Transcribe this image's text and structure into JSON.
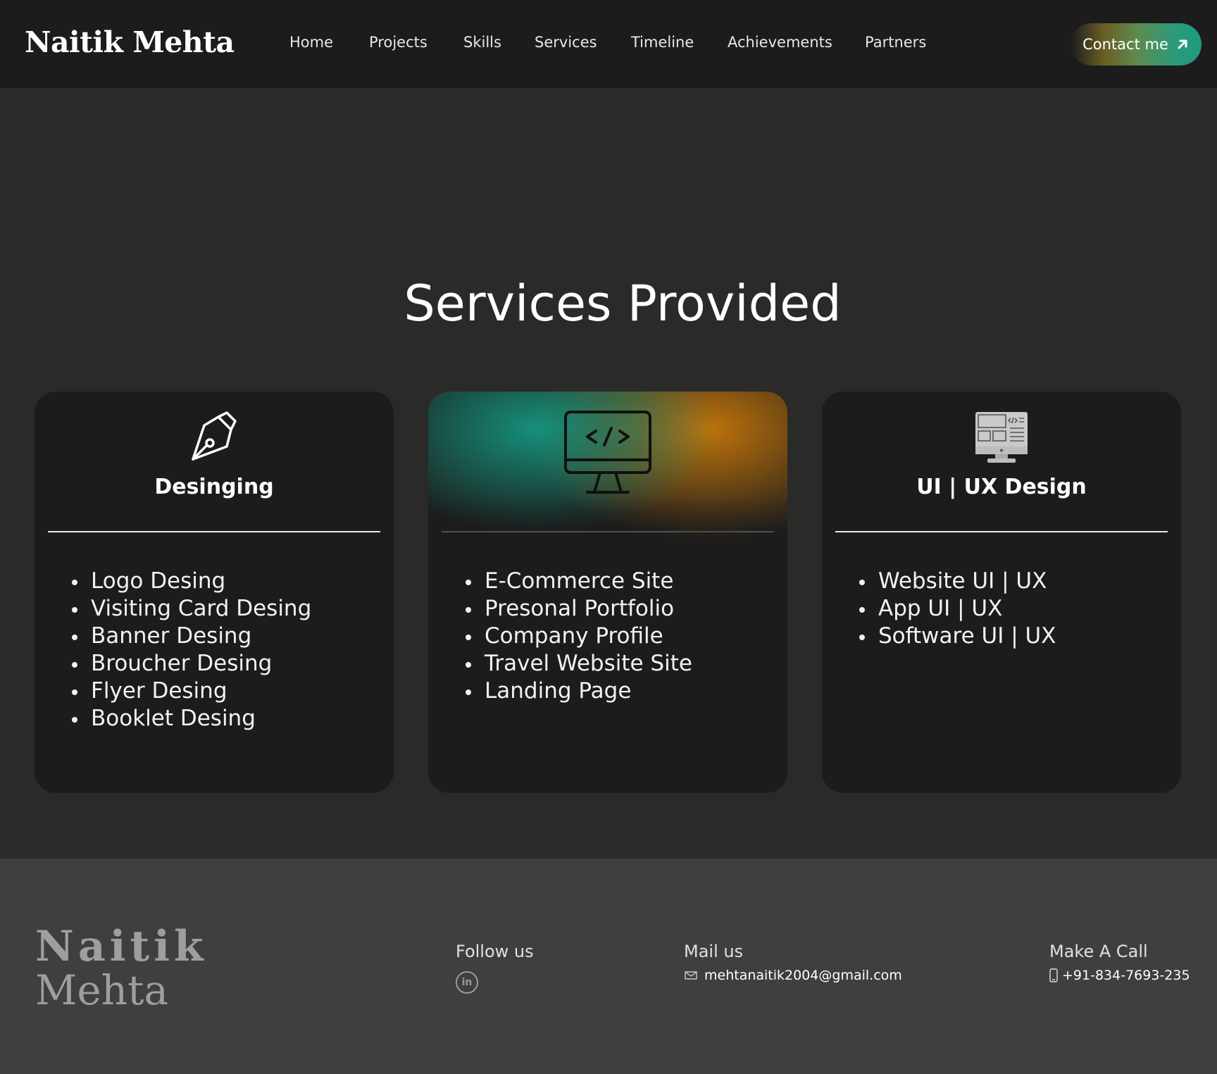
{
  "header": {
    "brand": "Naitik Mehta",
    "nav": [
      "Home",
      "Projects",
      "Skills",
      "Services",
      "Timeline",
      "Achievements",
      "Partners"
    ],
    "contact_label": "Contact me",
    "contact_icon": "arrow-up-right-icon"
  },
  "main": {
    "title": "Services Provided",
    "cards": [
      {
        "icon": "pen-tool-icon",
        "title": "Desinging",
        "items": [
          "Logo Desing",
          "Visiting Card Desing",
          "Banner Desing",
          "Broucher Desing",
          "Flyer Desing",
          "Booklet Desing"
        ]
      },
      {
        "icon": "code-monitor-icon",
        "title": "",
        "items": [
          "E-Commerce Site",
          "Presonal Portfolio",
          "Company Profile",
          "Travel Website Site",
          "Landing Page"
        ]
      },
      {
        "icon": "ui-ux-computer-icon",
        "title": "UI | UX Design",
        "items": [
          "Website UI | UX",
          "App UI | UX",
          "Software UI | UX"
        ]
      }
    ]
  },
  "footer": {
    "brand_line1": "Naitik",
    "brand_line2": "Mehta",
    "follow_label": "Follow us",
    "linkedin_icon": "linkedin-icon",
    "linkedin_text": "in",
    "mail_label": "Mail us",
    "email": "mehtanaitik2004@gmail.com",
    "call_label": "Make A Call",
    "phone": "+91-834-7693-235"
  },
  "colors": {
    "header_bg": "#1c1c1c",
    "page_bg": "#2a2a29",
    "card_bg": "#1c1c1c",
    "footer_bg": "#3f3f3f",
    "accent_teal": "#1e9b7d",
    "accent_orange": "#c8780a"
  }
}
